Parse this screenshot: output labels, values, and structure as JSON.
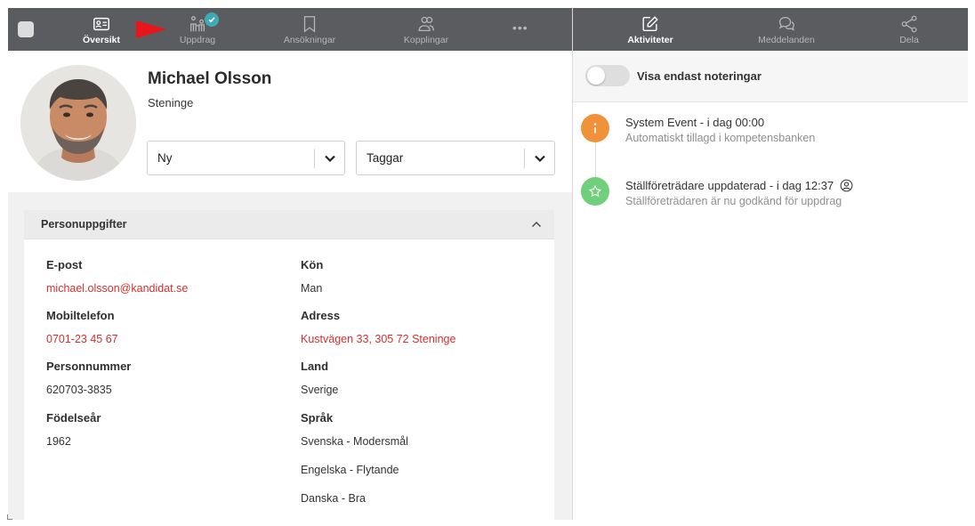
{
  "nav_left": {
    "items": [
      {
        "label": "Översikt",
        "icon": "id-card-icon"
      },
      {
        "label": "Uppdrag",
        "icon": "people-icon"
      },
      {
        "label": "Ansökningar",
        "icon": "bookmark-icon"
      },
      {
        "label": "Kopplingar",
        "icon": "users-icon"
      }
    ],
    "more": "•••"
  },
  "nav_right": {
    "items": [
      {
        "label": "Aktiviteter",
        "icon": "edit-icon"
      },
      {
        "label": "Meddelanden",
        "icon": "chat-icon"
      },
      {
        "label": "Dela",
        "icon": "share-icon"
      }
    ]
  },
  "profile": {
    "name": "Michael Olsson",
    "location": "Steninge",
    "status_select": "Ny",
    "tags_select": "Taggar"
  },
  "personal": {
    "title": "Personuppgifter",
    "email_label": "E-post",
    "email": "michael.olsson@kandidat.se",
    "mobile_label": "Mobiltelefon",
    "mobile": "0701-23 45 67",
    "ssn_label": "Personnummer",
    "ssn": "620703-3835",
    "birth_label": "Födelseår",
    "birth": "1962",
    "gender_label": "Kön",
    "gender": "Man",
    "address_label": "Adress",
    "address": "Kustvägen 33, 305 72 Steninge",
    "country_label": "Land",
    "country": "Sverige",
    "language_label": "Språk",
    "languages": [
      "Svenska - Modersmål",
      "Engelska - Flytande",
      "Danska - Bra"
    ]
  },
  "activities": {
    "filter_label": "Visa endast noteringar",
    "events": [
      {
        "title": "System Event - i dag 00:00",
        "subtitle": "Automatiskt tillagd i kompetensbanken"
      },
      {
        "title": "Ställföreträdare uppdaterad - i dag 12:37",
        "subtitle": "Ställföreträdaren är nu godkänd för uppdrag"
      }
    ]
  },
  "colors": {
    "topbar": "#5a5c60",
    "link_red": "#d32f2f",
    "badge_teal": "#3fa9b5",
    "event_orange": "#f0923a",
    "event_green": "#6fcf7a"
  }
}
